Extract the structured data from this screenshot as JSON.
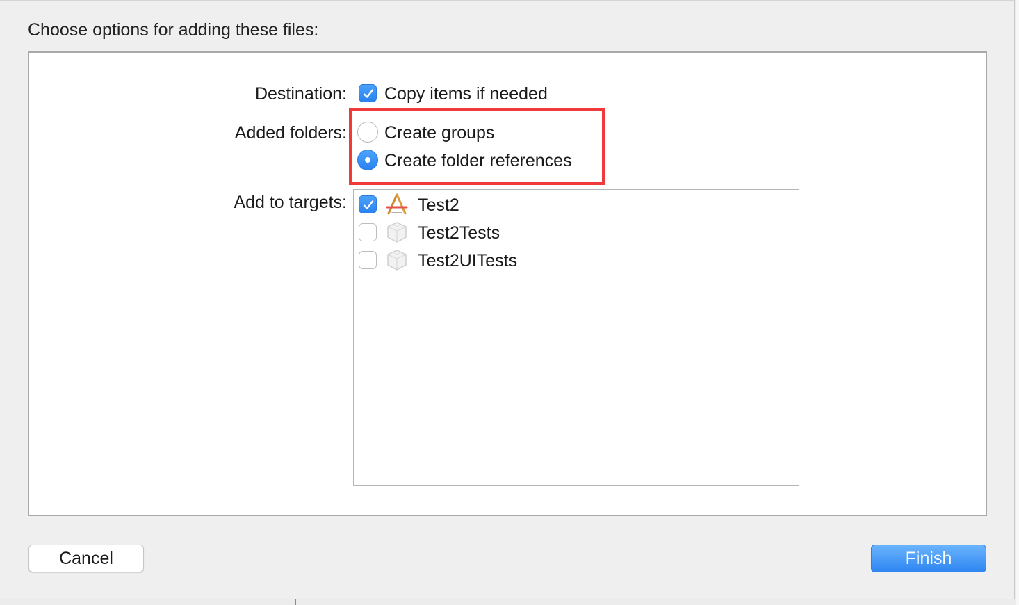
{
  "dialog": {
    "heading": "Choose options for adding these files:"
  },
  "destination": {
    "label": "Destination:",
    "copy_items": {
      "label": "Copy items if needed",
      "checked": true
    }
  },
  "added_folders": {
    "label": "Added folders:",
    "options": [
      {
        "label": "Create groups",
        "selected": false
      },
      {
        "label": "Create folder references",
        "selected": true
      }
    ]
  },
  "targets": {
    "label": "Add to targets:",
    "items": [
      {
        "name": "Test2",
        "checked": true,
        "icon": "app-target-icon"
      },
      {
        "name": "Test2Tests",
        "checked": false,
        "icon": "test-bundle-icon"
      },
      {
        "name": "Test2UITests",
        "checked": false,
        "icon": "test-bundle-icon"
      }
    ]
  },
  "buttons": {
    "cancel": "Cancel",
    "finish": "Finish"
  },
  "colors": {
    "accent": "#2a82f0",
    "highlight": "#f0393a"
  }
}
